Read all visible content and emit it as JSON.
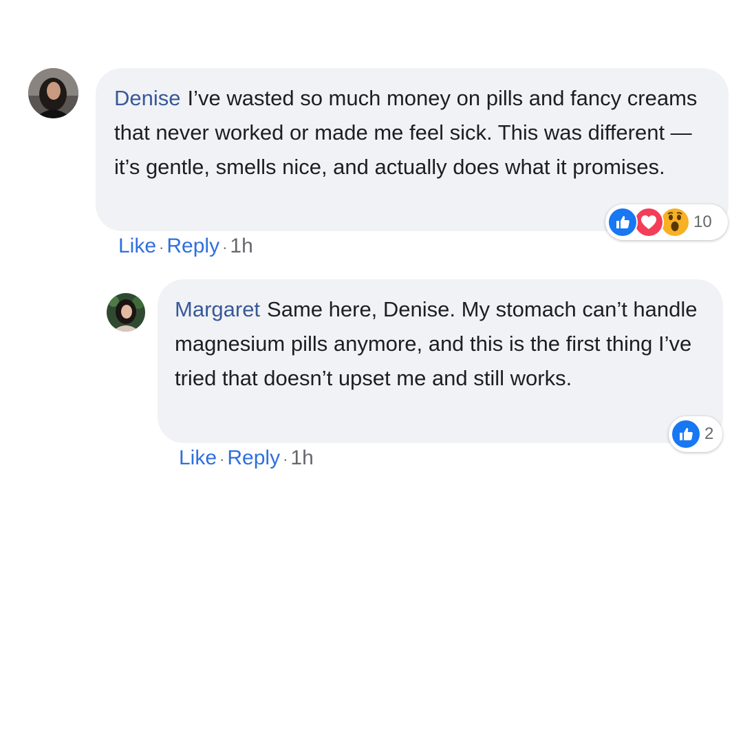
{
  "comments": [
    {
      "author": "Denise",
      "text": "I’ve wasted so much money on pills and fancy creams that never worked or made me feel sick. This was different — it’s gentle, smells nice, and actually does what it promises.",
      "reactions": {
        "icons": [
          "like-icon",
          "love-icon",
          "wow-icon"
        ],
        "count": "10"
      },
      "actions": {
        "like": "Like",
        "reply": "Reply",
        "separator": "·",
        "time": "1h"
      }
    },
    {
      "author": "Margaret",
      "text": "Same here, Denise. My stomach can’t handle magnesium pills anymore, and this is the first thing I’ve tried that doesn’t upset me and still works.",
      "reactions": {
        "icons": [
          "like-icon"
        ],
        "count": "2"
      },
      "actions": {
        "like": "Like",
        "reply": "Reply",
        "separator": "·",
        "time": "1h"
      }
    }
  ],
  "colors": {
    "bubble": "#f0f2f5",
    "author": "#385898",
    "link": "#2e6fde",
    "like": "#1877f2",
    "love": "#f33e58",
    "wow": "#f7b125",
    "muted": "#65676b"
  }
}
